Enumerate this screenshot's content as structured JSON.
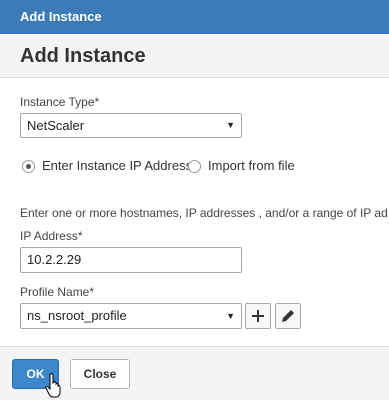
{
  "window": {
    "title": "Add Instance"
  },
  "dialog": {
    "heading": "Add Instance"
  },
  "instance_type": {
    "label": "Instance Type*",
    "selected": "NetScaler"
  },
  "source": {
    "options": [
      {
        "label": "Enter Instance IP Address",
        "checked": true
      },
      {
        "label": "Import from file",
        "checked": false
      }
    ]
  },
  "hint": "Enter one or more hostnames, IP addresses , and/or a range of IP ad",
  "ip_address": {
    "label": "IP Address*",
    "value": "10.2.2.29"
  },
  "profile": {
    "label": "Profile Name*",
    "selected": "ns_nsroot_profile"
  },
  "buttons": {
    "ok": "OK",
    "close": "Close"
  }
}
